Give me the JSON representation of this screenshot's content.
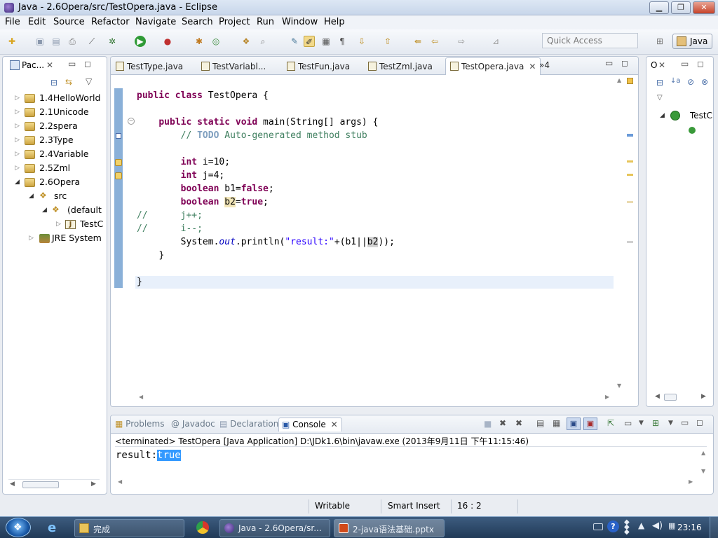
{
  "window": {
    "title": "Java - 2.6Opera/src/TestOpera.java - Eclipse"
  },
  "menu": [
    "File",
    "Edit",
    "Source",
    "Refactor",
    "Navigate",
    "Search",
    "Project",
    "Run",
    "Window",
    "Help"
  ],
  "toolbar": {
    "quick_access_placeholder": "Quick Access",
    "perspective": "Java"
  },
  "package_explorer": {
    "tab_label": "Pac...",
    "tree": [
      {
        "label": "1.4HelloWorld"
      },
      {
        "label": "2.1Unicode"
      },
      {
        "label": "2.2spera"
      },
      {
        "label": "2.3Type"
      },
      {
        "label": "2.4Variable"
      },
      {
        "label": "2.5Zml"
      },
      {
        "label": "2.6Opera"
      },
      {
        "label": "src"
      },
      {
        "label": "(default"
      },
      {
        "label": "TestC"
      },
      {
        "label": "JRE System"
      }
    ]
  },
  "editor": {
    "tabs": [
      "TestType.java",
      "TestVariabl...",
      "TestFun.java",
      "TestZml.java",
      "TestOpera.java"
    ],
    "overflow": "»4",
    "code": {
      "l1_kw": "public class",
      "l1_rest": " TestOpera {",
      "l3_kw": "public static void",
      "l3_rest": " main(String[] args) {",
      "l4_c1": "// ",
      "l4_todo": "TODO",
      "l4_c2": " Auto-generated method stub",
      "l6_kw": "int",
      "l6_rest": " i=10;",
      "l7_kw": "int",
      "l7_rest": " j=4;",
      "l8_kw": "boolean",
      "l8_a": " b1=",
      "l8_v": "false",
      "l8_e": ";",
      "l9_kw": "boolean",
      "l9_sp": " ",
      "l9_b2": "b2",
      "l9_eq": "=",
      "l9_v": "true",
      "l9_e": ";",
      "l10": "//      j++;",
      "l11": "//      i--;",
      "l12_a": "System.",
      "l12_out": "out",
      "l12_b": ".println(",
      "l12_s": "\"result:\"",
      "l12_c": "+(b1||",
      "l12_b2": "b2",
      "l12_d": "));",
      "l13": "}",
      "l15": "}"
    }
  },
  "outline": {
    "tab_label": "O",
    "item": "TestC"
  },
  "bottom": {
    "tabs": [
      "Problems",
      "@ Javadoc",
      "Declaration",
      "Console"
    ],
    "console_header": "<terminated> TestOpera [Java Application] D:\\JDk1.6\\bin\\javaw.exe (2013年9月11日 下午11:15:46)",
    "output_prefix": "result:",
    "output_value": "true"
  },
  "status": {
    "writable": "Writable",
    "insert_mode": "Smart Insert",
    "position": "16 : 2"
  },
  "taskbar": {
    "items": [
      "完成",
      "Java - 2.6Opera/sr...",
      "2-java语法基础.pptx"
    ],
    "clock": "23:16"
  },
  "colors": {
    "keyword": "#7f0055",
    "comment": "#3f7f5f",
    "string": "#2a00ff",
    "selection": "#3399ff"
  }
}
